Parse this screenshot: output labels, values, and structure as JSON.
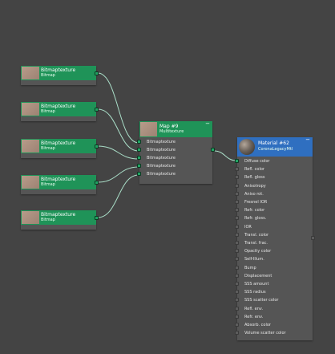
{
  "bitmap_nodes": [
    {
      "title": "Bitmaptexture",
      "subtitle": "Bitmap"
    },
    {
      "title": "Bitmaptexture",
      "subtitle": "Bitmap"
    },
    {
      "title": "Bitmaptexture",
      "subtitle": "Bitmap"
    },
    {
      "title": "Bitmaptexture",
      "subtitle": "Bitmap"
    },
    {
      "title": "Bitmaptexture",
      "subtitle": "Bitmap"
    }
  ],
  "multi_node": {
    "title": "Map #9",
    "subtitle": "Multitexture",
    "minimize": "−",
    "inputs": [
      "Bitmaptexture",
      "Bitmaptexture",
      "Bitmaptexture",
      "Bitmaptexture",
      "Bitmaptexture"
    ]
  },
  "material_node": {
    "title": "Material #62",
    "subtitle": "CoronaLegacyMtl",
    "minimize": "−",
    "slots": [
      "Diffuse color",
      "Refl. color",
      "Refl. gloss",
      "Anisotropy",
      "Aniso rot.",
      "Fresnel IOR",
      "Refr. color",
      "Refr. gloss.",
      "IOR",
      "Transl. color",
      "Transl. frac.",
      "Opacity color",
      "Self-Illum.",
      "Bump",
      "Displacement",
      "SSS amount",
      "SSS radius",
      "SSS scatter color",
      "Refl. env.",
      "Refr. env.",
      "Absorb. color",
      "Volume scatter color"
    ]
  },
  "colors": {
    "canvas": "#444444",
    "node_header_green": "#1f9358",
    "node_header_blue": "#2f6fc0",
    "node_body": "#555555",
    "wire": "#a9ddc7"
  }
}
